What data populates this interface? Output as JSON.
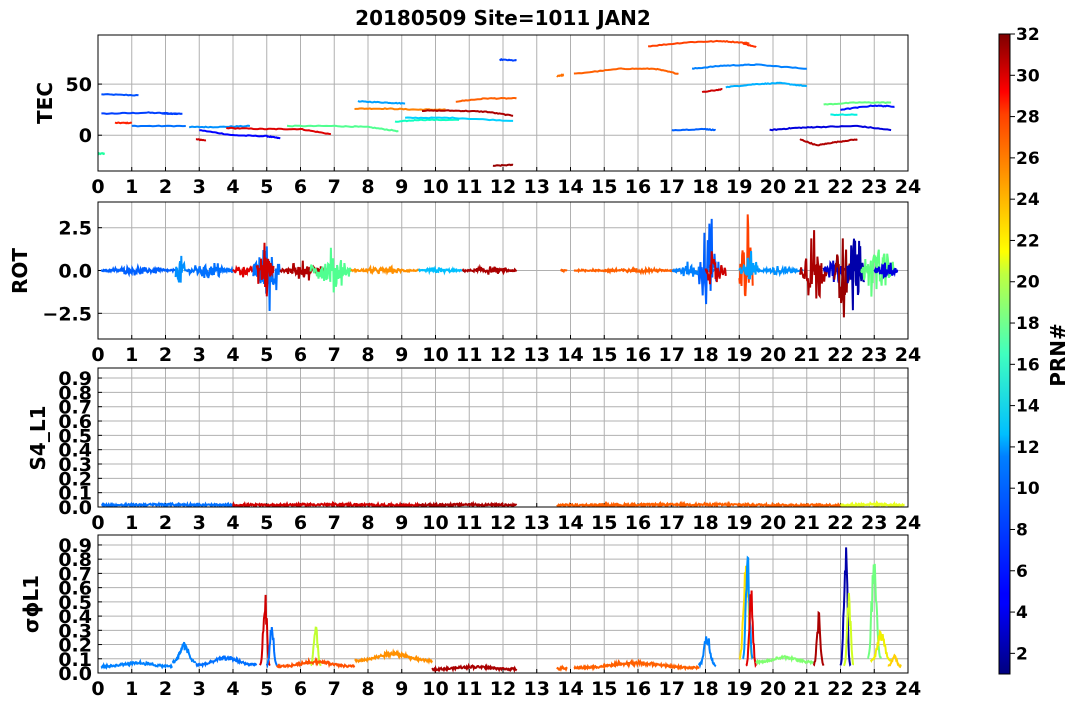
{
  "title": "20180509 Site=1011 JAN2",
  "colorbar": {
    "label": "PRN#",
    "range": [
      1,
      32
    ],
    "ticks": [
      2,
      4,
      6,
      8,
      10,
      12,
      14,
      16,
      18,
      20,
      22,
      24,
      26,
      28,
      30,
      32
    ],
    "colormap": "jet"
  },
  "chart_data": [
    {
      "type": "line",
      "ylabel": "TEC",
      "xlim": [
        0,
        24
      ],
      "ylim": [
        -35,
        98
      ],
      "xticks": [
        0,
        1,
        2,
        3,
        4,
        5,
        6,
        7,
        8,
        9,
        10,
        11,
        12,
        13,
        14,
        15,
        16,
        17,
        18,
        19,
        20,
        21,
        22,
        23,
        24
      ],
      "yticks": [
        0,
        50
      ],
      "ytick_labels": [
        "0",
        "50"
      ],
      "grid": true,
      "series": [
        {
          "prn": 6,
          "color": "#0050ff",
          "x": [
            0.1,
            1.2
          ],
          "y": [
            40,
            39
          ]
        },
        {
          "prn": 7,
          "color": "#0040ff",
          "x": [
            0.1,
            1.5,
            2.5,
            1.9
          ],
          "y": [
            21,
            22,
            21,
            21
          ]
        },
        {
          "prn": 8,
          "color": "#0070ff",
          "x": [
            1.0,
            2.6
          ],
          "y": [
            9,
            9
          ]
        },
        {
          "prn": 29,
          "color": "#ff2000",
          "x": [
            0.5,
            1.0
          ],
          "y": [
            12,
            12
          ]
        },
        {
          "prn": 14,
          "color": "#20ffa0",
          "x": [
            0.0,
            0.2
          ],
          "y": [
            -18,
            -18
          ]
        },
        {
          "prn": 30,
          "color": "#cc0000",
          "x": [
            2.9,
            3.2
          ],
          "y": [
            -4,
            -5
          ]
        },
        {
          "prn": 9,
          "color": "#0090ff",
          "x": [
            2.7,
            3.5,
            4.5
          ],
          "y": [
            8,
            8,
            9
          ]
        },
        {
          "prn": 4,
          "color": "#0000ff",
          "x": [
            3.0,
            4.0,
            5.0,
            5.4
          ],
          "y": [
            5,
            0,
            -1,
            -3
          ]
        },
        {
          "prn": 29,
          "color": "#dd0000",
          "x": [
            3.8,
            5.0,
            6.0,
            6.9
          ],
          "y": [
            7,
            6,
            6,
            1
          ]
        },
        {
          "prn": 17,
          "color": "#50ff90",
          "x": [
            5.6,
            7.0,
            8.0,
            8.9
          ],
          "y": [
            9,
            9,
            8,
            4
          ]
        },
        {
          "prn": 10,
          "color": "#00a0ff",
          "x": [
            7.7,
            8.5,
            9.1
          ],
          "y": [
            33,
            32,
            31
          ]
        },
        {
          "prn": 25,
          "color": "#ff8000",
          "x": [
            7.6,
            8.5,
            9.5,
            10.3
          ],
          "y": [
            26,
            26,
            25,
            25
          ]
        },
        {
          "prn": 14,
          "color": "#10ffc0",
          "x": [
            8.8,
            9.5,
            10.7
          ],
          "y": [
            13,
            15,
            15
          ]
        },
        {
          "prn": 12,
          "color": "#00d0ff",
          "x": [
            9.1,
            10.5,
            12.3
          ],
          "y": [
            17,
            17,
            14
          ]
        },
        {
          "prn": 31,
          "color": "#aa0000",
          "x": [
            9.6,
            10.6,
            11.5,
            12.3
          ],
          "y": [
            24,
            24,
            23,
            19
          ]
        },
        {
          "prn": 26,
          "color": "#ff6000",
          "x": [
            10.6,
            11.5,
            12.4
          ],
          "y": [
            33,
            36,
            36
          ]
        },
        {
          "prn": 7,
          "color": "#0040ff",
          "x": [
            11.9,
            12.4
          ],
          "y": [
            74,
            73
          ]
        },
        {
          "prn": 31,
          "color": "#990000",
          "x": [
            11.7,
            12.3
          ],
          "y": [
            -30,
            -29
          ]
        },
        {
          "prn": 26,
          "color": "#ff7000",
          "x": [
            13.6,
            13.8
          ],
          "y": [
            58,
            59
          ]
        },
        {
          "prn": 26,
          "color": "#ff6000",
          "x": [
            14.1,
            15.5,
            16.5,
            17.2
          ],
          "y": [
            60,
            65,
            65,
            60
          ]
        },
        {
          "prn": 27,
          "color": "#ff4000",
          "x": [
            16.3,
            17.5,
            18.5,
            19.3
          ],
          "y": [
            87,
            91,
            92,
            90
          ]
        },
        {
          "prn": 28,
          "color": "#ff3000",
          "x": [
            19.1,
            19.5
          ],
          "y": [
            90,
            86
          ]
        },
        {
          "prn": 8,
          "color": "#0060ff",
          "x": [
            17.0,
            18.0,
            18.3
          ],
          "y": [
            5,
            6,
            5
          ]
        },
        {
          "prn": 9,
          "color": "#0080ff",
          "x": [
            17.6,
            18.5,
            19.5,
            21.0
          ],
          "y": [
            65,
            68,
            69,
            65
          ]
        },
        {
          "prn": 11,
          "color": "#00b0ff",
          "x": [
            18.6,
            19.5,
            20.2,
            21.0
          ],
          "y": [
            47,
            50,
            51,
            48
          ]
        },
        {
          "prn": 30,
          "color": "#cc0000",
          "x": [
            17.9,
            18.5
          ],
          "y": [
            42,
            45
          ]
        },
        {
          "prn": 3,
          "color": "#0000dd",
          "x": [
            19.9,
            20.6,
            21.3,
            22.5,
            23.5
          ],
          "y": [
            5,
            7,
            8,
            9,
            5
          ]
        },
        {
          "prn": 31,
          "color": "#b00000",
          "x": [
            20.8,
            21.3,
            21.8,
            22.5
          ],
          "y": [
            -4,
            -10,
            -7,
            -4
          ]
        },
        {
          "prn": 17,
          "color": "#60ff80",
          "x": [
            21.5,
            22.5,
            23.5
          ],
          "y": [
            30,
            32,
            32
          ]
        },
        {
          "prn": 13,
          "color": "#00f0e0",
          "x": [
            21.7,
            22.5
          ],
          "y": [
            20,
            20
          ]
        },
        {
          "prn": 5,
          "color": "#0010ff",
          "x": [
            22.0,
            23.0,
            23.6
          ],
          "y": [
            25,
            29,
            28
          ]
        }
      ]
    },
    {
      "type": "line",
      "ylabel": "ROT",
      "xlim": [
        0,
        24
      ],
      "ylim": [
        -4,
        4
      ],
      "xticks": [
        0,
        1,
        2,
        3,
        4,
        5,
        6,
        7,
        8,
        9,
        10,
        11,
        12,
        13,
        14,
        15,
        16,
        17,
        18,
        19,
        20,
        21,
        22,
        23,
        24
      ],
      "yticks": [
        -2.5,
        0,
        2.5
      ],
      "ytick_labels": [
        "−2.5",
        "0.0",
        "2.5"
      ],
      "grid": true,
      "bursts": [
        {
          "prn": 6,
          "color": "#0060ff",
          "start": 0.1,
          "end": 2.3,
          "amp": 0.3
        },
        {
          "prn": 9,
          "color": "#0090ff",
          "start": 2.3,
          "end": 2.6,
          "amp": 1.8
        },
        {
          "prn": 8,
          "color": "#0070ff",
          "start": 2.6,
          "end": 4.0,
          "amp": 0.6
        },
        {
          "prn": 29,
          "color": "#e00000",
          "start": 4.0,
          "end": 4.6,
          "amp": 0.5
        },
        {
          "prn": 8,
          "color": "#0070ff",
          "start": 4.6,
          "end": 5.4,
          "amp": 3.0
        },
        {
          "prn": 29,
          "color": "#d00000",
          "start": 4.7,
          "end": 5.2,
          "amp": 2.5
        },
        {
          "prn": 31,
          "color": "#b00000",
          "start": 5.4,
          "end": 6.9,
          "amp": 0.6
        },
        {
          "prn": 17,
          "color": "#50ff90",
          "start": 6.3,
          "end": 7.5,
          "amp": 1.5
        },
        {
          "prn": 25,
          "color": "#ff9000",
          "start": 7.5,
          "end": 9.5,
          "amp": 0.25
        },
        {
          "prn": 12,
          "color": "#00c0ff",
          "start": 9.5,
          "end": 10.8,
          "amp": 0.2
        },
        {
          "prn": 31,
          "color": "#aa0000",
          "start": 10.8,
          "end": 12.4,
          "amp": 0.25
        },
        {
          "prn": 26,
          "color": "#ff6000",
          "start": 13.7,
          "end": 13.9,
          "amp": 0.15
        },
        {
          "prn": 26,
          "color": "#ff6000",
          "start": 14.1,
          "end": 17.3,
          "amp": 0.15
        },
        {
          "prn": 9,
          "color": "#0080ff",
          "start": 17.0,
          "end": 18.3,
          "amp": 0.6
        },
        {
          "prn": 8,
          "color": "#0060ff",
          "start": 17.8,
          "end": 18.4,
          "amp": 4.0
        },
        {
          "prn": 30,
          "color": "#cc0000",
          "start": 18.0,
          "end": 18.6,
          "amp": 1.5
        },
        {
          "prn": 27,
          "color": "#ff4000",
          "start": 19.0,
          "end": 19.4,
          "amp": 4.0
        },
        {
          "prn": 10,
          "color": "#00a0ff",
          "start": 19.0,
          "end": 19.6,
          "amp": 1.2
        },
        {
          "prn": 10,
          "color": "#0090ff",
          "start": 19.5,
          "end": 20.9,
          "amp": 0.3
        },
        {
          "prn": 31,
          "color": "#aa0000",
          "start": 20.8,
          "end": 21.6,
          "amp": 2.5
        },
        {
          "prn": 3,
          "color": "#0000cc",
          "start": 21.5,
          "end": 22.3,
          "amp": 0.8
        },
        {
          "prn": 31,
          "color": "#990000",
          "start": 21.8,
          "end": 22.3,
          "amp": 4.0
        },
        {
          "prn": 2,
          "color": "#0000aa",
          "start": 22.2,
          "end": 22.7,
          "amp": 3.0
        },
        {
          "prn": 17,
          "color": "#60ff80",
          "start": 22.6,
          "end": 23.6,
          "amp": 2.0
        },
        {
          "prn": 3,
          "color": "#0000dd",
          "start": 23.0,
          "end": 23.7,
          "amp": 0.8
        }
      ]
    },
    {
      "type": "line",
      "ylabel": "S4_L1",
      "xlim": [
        0,
        24
      ],
      "ylim": [
        0,
        0.97
      ],
      "xticks": [
        0,
        1,
        2,
        3,
        4,
        5,
        6,
        7,
        8,
        9,
        10,
        11,
        12,
        13,
        14,
        15,
        16,
        17,
        18,
        19,
        20,
        21,
        22,
        23,
        24
      ],
      "yticks": [
        0.0,
        0.1,
        0.2,
        0.3,
        0.4,
        0.5,
        0.6,
        0.7,
        0.8,
        0.9
      ],
      "ytick_labels": [
        "0.0",
        "0.1",
        "0.2",
        "0.3",
        "0.4",
        "0.5",
        "0.6",
        "0.7",
        "0.8",
        "0.9"
      ],
      "grid": true,
      "bursts": [
        {
          "prn": 8,
          "color": "#0070ff",
          "start": 0.1,
          "end": 4.0,
          "base": 0.005,
          "amp": 0.005
        },
        {
          "prn": 29,
          "color": "#d00000",
          "start": 4.0,
          "end": 9.5,
          "base": 0.005,
          "amp": 0.005
        },
        {
          "prn": 31,
          "color": "#aa0000",
          "start": 9.5,
          "end": 12.4,
          "base": 0.005,
          "amp": 0.005
        },
        {
          "prn": 26,
          "color": "#ff6000",
          "start": 13.6,
          "end": 22.0,
          "base": 0.005,
          "amp": 0.005
        },
        {
          "prn": 21,
          "color": "#e8ff20",
          "start": 22.0,
          "end": 23.9,
          "base": 0.005,
          "amp": 0.008
        }
      ]
    },
    {
      "type": "line",
      "ylabel": "σϕL1",
      "xlim": [
        0,
        24
      ],
      "ylim": [
        0,
        0.97
      ],
      "xticks": [
        0,
        1,
        2,
        3,
        4,
        5,
        6,
        7,
        8,
        9,
        10,
        11,
        12,
        13,
        14,
        15,
        16,
        17,
        18,
        19,
        20,
        21,
        22,
        23,
        24
      ],
      "yticks": [
        0.0,
        0.1,
        0.2,
        0.3,
        0.4,
        0.5,
        0.6,
        0.7,
        0.8,
        0.9
      ],
      "ytick_labels": [
        "0.0",
        "0.1",
        "0.2",
        "0.3",
        "0.4",
        "0.5",
        "0.6",
        "0.7",
        "0.8",
        "0.9"
      ],
      "grid": true,
      "bursts": [
        {
          "prn": 9,
          "color": "#0080ff",
          "start": 0.1,
          "end": 2.2,
          "base": 0.04,
          "amp": 0.03
        },
        {
          "prn": 9,
          "color": "#0080ff",
          "start": 2.2,
          "end": 2.9,
          "base": 0.07,
          "amp": 0.14
        },
        {
          "prn": 8,
          "color": "#0070ff",
          "start": 2.9,
          "end": 4.7,
          "base": 0.05,
          "amp": 0.06
        },
        {
          "prn": 29,
          "color": "#d00000",
          "start": 4.8,
          "end": 5.1,
          "base": 0.05,
          "amp": 0.52
        },
        {
          "prn": 8,
          "color": "#0070ff",
          "start": 5.0,
          "end": 5.3,
          "base": 0.05,
          "amp": 0.3
        },
        {
          "prn": 22,
          "color": "#c0ff30",
          "start": 6.3,
          "end": 6.6,
          "base": 0.05,
          "amp": 0.3
        },
        {
          "prn": 27,
          "color": "#ff5000",
          "start": 5.3,
          "end": 7.6,
          "base": 0.04,
          "amp": 0.04
        },
        {
          "prn": 25,
          "color": "#ff9000",
          "start": 7.6,
          "end": 9.9,
          "base": 0.08,
          "amp": 0.06
        },
        {
          "prn": 31,
          "color": "#aa0000",
          "start": 9.9,
          "end": 12.4,
          "base": 0.02,
          "amp": 0.02
        },
        {
          "prn": 26,
          "color": "#ff6000",
          "start": 13.6,
          "end": 13.9,
          "base": 0.02,
          "amp": 0.01
        },
        {
          "prn": 26,
          "color": "#ff6000",
          "start": 14.1,
          "end": 17.8,
          "base": 0.03,
          "amp": 0.04
        },
        {
          "prn": 9,
          "color": "#0080ff",
          "start": 17.8,
          "end": 18.3,
          "base": 0.05,
          "amp": 0.22
        },
        {
          "prn": 23,
          "color": "#ffe000",
          "start": 19.0,
          "end": 19.4,
          "base": 0.1,
          "amp": 0.78
        },
        {
          "prn": 10,
          "color": "#0090ff",
          "start": 19.1,
          "end": 19.4,
          "base": 0.1,
          "amp": 0.85
        },
        {
          "prn": 29,
          "color": "#e00000",
          "start": 19.2,
          "end": 19.5,
          "base": 0.05,
          "amp": 0.55
        },
        {
          "prn": 18,
          "color": "#80ff70",
          "start": 19.5,
          "end": 21.2,
          "base": 0.07,
          "amp": 0.04
        },
        {
          "prn": 31,
          "color": "#aa0000",
          "start": 21.2,
          "end": 21.5,
          "base": 0.05,
          "amp": 0.38
        },
        {
          "prn": 2,
          "color": "#0000aa",
          "start": 22.0,
          "end": 22.3,
          "base": 0.05,
          "amp": 0.87
        },
        {
          "prn": 20,
          "color": "#d0ff20",
          "start": 22.1,
          "end": 22.4,
          "base": 0.05,
          "amp": 0.5
        },
        {
          "prn": 16,
          "color": "#70ff80",
          "start": 22.8,
          "end": 23.2,
          "base": 0.1,
          "amp": 0.8
        },
        {
          "prn": 22,
          "color": "#f0f000",
          "start": 22.9,
          "end": 23.5,
          "base": 0.08,
          "amp": 0.22
        },
        {
          "prn": 23,
          "color": "#ffd000",
          "start": 23.4,
          "end": 23.8,
          "base": 0.04,
          "amp": 0.08
        }
      ]
    }
  ]
}
